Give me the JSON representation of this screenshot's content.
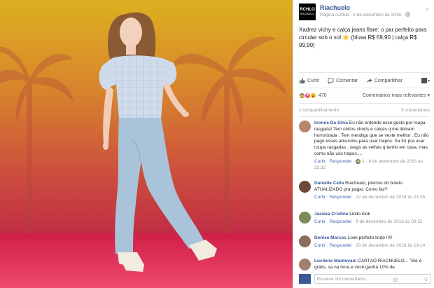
{
  "page": {
    "name": "Riachuelo",
    "logo_line1": "RCHLO",
    "logo_line2": "RIACHUELO",
    "subtitle": "Página curtida · 8 de dezembro de 2016 · ",
    "globe_icon": "globe-icon"
  },
  "post": {
    "caption": "Xadrez vichy e calça jeans flare: o par perfeito para circular sob o sol ☀️ (blusa R$ 69,90 | calça R$ 99,90)"
  },
  "actions": {
    "like": "Curtir",
    "comment": "Comentar",
    "share": "Compartilhar"
  },
  "reactions": {
    "count": "470",
    "relevance": "Comentários mais relevantes ▾"
  },
  "counts": {
    "shares": "1 compartilhamento",
    "comments": "5 comentários"
  },
  "comments": [
    {
      "name": "Ivonne Da Silva",
      "text": "Eu não entendo esse gosto por roupa rasgada! Tem certos shorts e calças q me deixam horrorizada . Tem mendigo que se veste melhor . Eu não pago esses absurdos para usar trapos. Sa for pra usar roupa rasgadas , rasgo as velhas q tenho em casa, mas como não uso trapos....",
      "like": "Curtir",
      "reply": "Responder",
      "likes": "1",
      "date": "8 de dezembro de 2016 às 22:32",
      "avatar_color": "#b4876a"
    },
    {
      "name": "Danielle Cella",
      "text": "Riachuelo, preciso do boleto ATUALIZADO pra pagar. Como faz?",
      "like": "Curtir",
      "reply": "Responder",
      "date": "12 de dezembro de 2016 às 23:35",
      "avatar_color": "#6b4a3a"
    },
    {
      "name": "Jaciara Cristina",
      "text": "Lindo look",
      "like": "Curtir",
      "reply": "Responder",
      "date": "9 de dezembro de 2016 às 09:52",
      "avatar_color": "#7d8a5a"
    },
    {
      "name": "Denise Marcos",
      "text": "Look perfeito lindo !!!!!",
      "like": "Curtir",
      "reply": "Responder",
      "date": "20 de dezembro de 2016 às 19:14",
      "avatar_color": "#8a6d5c"
    },
    {
      "name": "Lucilene Mantovani",
      "text": "CARTÃO RIACHUELO... \"Ele é grátis, sa na hora e você ganha 10% de",
      "avatar_color": "#a08070"
    }
  ],
  "input": {
    "placeholder": "Escreva um comentário..."
  },
  "colors": {
    "link": "#365899",
    "brand": "#4267b2",
    "photo_top": "#e0b21f",
    "photo_floor": "#d4204a"
  }
}
